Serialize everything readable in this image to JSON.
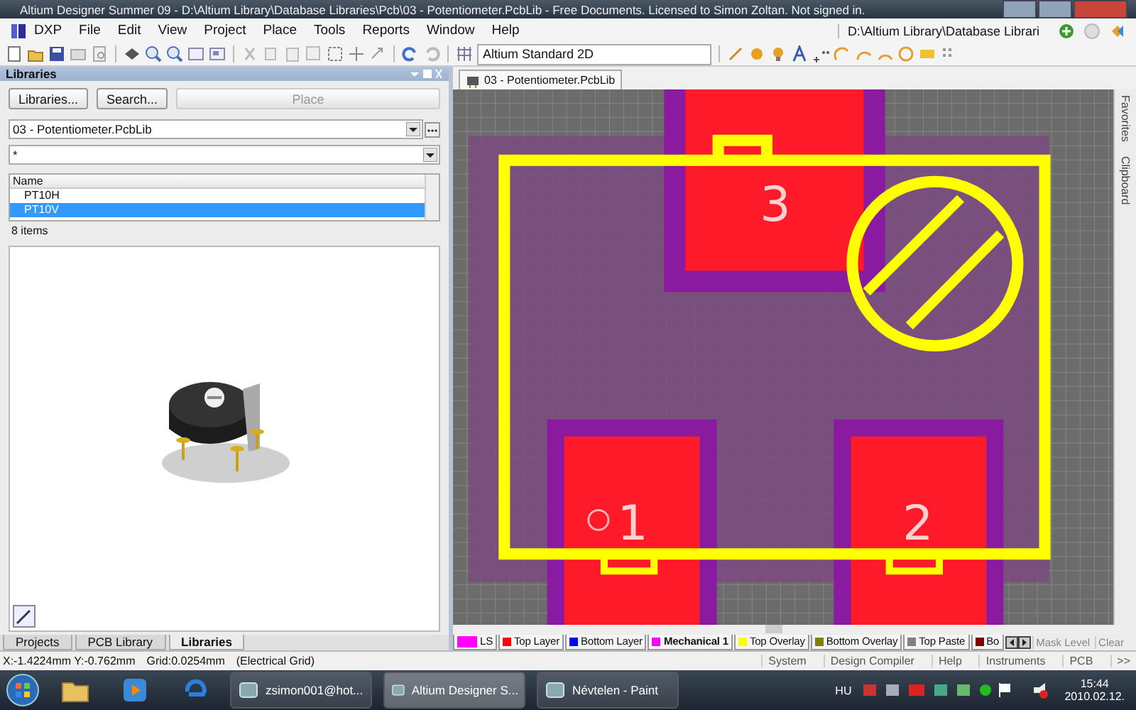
{
  "window": {
    "title": "Altium Designer Summer 09 - D:\\Altium Library\\Database Libraries\\Pcb\\03 - Potentiometer.PcbLib - Free Documents. Licensed to Simon Zoltan. Not signed in."
  },
  "menu": [
    "DXP",
    "File",
    "Edit",
    "View",
    "Project",
    "Place",
    "Tools",
    "Reports",
    "Window",
    "Help"
  ],
  "path_box": "D:\\Altium Library\\Database Librari",
  "view_select": "Altium Standard 2D",
  "libraries_panel": {
    "title": "Libraries",
    "buttons": [
      {
        "label": "Libraries...",
        "disabled": false
      },
      {
        "label": "Search...",
        "disabled": false
      },
      {
        "label": "Place",
        "disabled": true
      }
    ],
    "library": "03 - Potentiometer.PcbLib",
    "filter": "*",
    "column": "Name",
    "items": [
      {
        "name": "PT10H",
        "selected": false
      },
      {
        "name": "PT10V",
        "selected": true
      }
    ],
    "count": "8 items"
  },
  "panel_tabs": [
    {
      "label": "Projects",
      "selected": false
    },
    {
      "label": "PCB Library",
      "selected": false
    },
    {
      "label": "Libraries",
      "selected": true
    }
  ],
  "document_tab": "03 - Potentiometer.PcbLib",
  "pads": [
    {
      "label": "3"
    },
    {
      "label": "1"
    },
    {
      "label": "2"
    }
  ],
  "side_panels": [
    "Favorites",
    "Clipboard"
  ],
  "layer_tabs": [
    {
      "label": "LS",
      "color": "#ff00ff",
      "selected": false
    },
    {
      "label": "Top Layer",
      "color": "#ff0000",
      "selected": false
    },
    {
      "label": "Bottom Layer",
      "color": "#0000ff",
      "selected": false
    },
    {
      "label": "Mechanical 1",
      "color": "#ff00ff",
      "selected": true
    },
    {
      "label": "Top Overlay",
      "color": "#ffff00",
      "selected": false
    },
    {
      "label": "Bottom Overlay",
      "color": "#808000",
      "selected": false
    },
    {
      "label": "Top Paste",
      "color": "#808080",
      "selected": false
    },
    {
      "label": "Bo",
      "color": "#800000",
      "selected": false
    }
  ],
  "layer_buttons": [
    "Mask Level",
    "Clear"
  ],
  "status_bar": {
    "coordinates": "X:-1.4224mm Y:-0.762mm",
    "grid": "Grid:0.0254mm",
    "grid_type": "(Electrical Grid)",
    "buttons": [
      "System",
      "Design Compiler",
      "Help",
      "Instruments",
      "PCB",
      ">>"
    ]
  },
  "taskbar": {
    "tasks": [
      {
        "label": "zsimon001@hot...",
        "selected": false
      },
      {
        "label": "Altium Designer S...",
        "selected": true
      },
      {
        "label": "Névtelen - Paint",
        "selected": false
      }
    ],
    "language": "HU",
    "time": "15:44",
    "date": "2010.02.12."
  }
}
